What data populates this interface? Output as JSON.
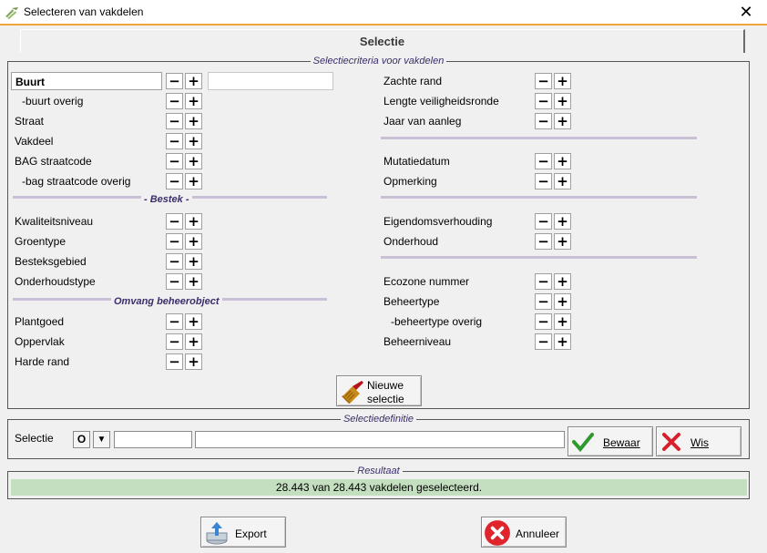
{
  "window": {
    "title": "Selecteren van vakdelen",
    "close_label": "✕"
  },
  "tab": {
    "label": "Selectie"
  },
  "criteria": {
    "title": "Selectiecriteria voor vakdelen",
    "left": [
      "Buurt",
      "-buurt overig",
      "Straat",
      "Vakdeel",
      "BAG straatcode",
      "-bag straatcode overig",
      "Kwaliteitsniveau",
      "Groentype",
      "Besteksgebied",
      "Onderhoudstype",
      "Plantgoed",
      "Oppervlak",
      "Harde rand"
    ],
    "left_sections": [
      "- Bestek -",
      "Omvang beheerobject"
    ],
    "right": [
      "Zachte rand",
      "Lengte veiligheidsronde",
      "Jaar van aanleg",
      "Mutatiedatum",
      "Opmerking",
      "Eigendomsverhouding",
      "Onderhoud",
      "Ecozone nummer",
      "Beheertype",
      "-beheertype overig",
      "Beheerniveau"
    ],
    "minus_label": "−",
    "plus_label": "+",
    "new_selection_line1": "Nieuwe",
    "new_selection_line2": "selectie"
  },
  "definition": {
    "title": "Selectiedefinitie",
    "label": "Selectie",
    "o_label": "O",
    "dropdown_label": "▼",
    "save_label": "Bewaar",
    "clear_label": "Wis"
  },
  "result": {
    "title": "Resultaat",
    "text": "28.443 van 28.443 vakdelen geselecteerd."
  },
  "footer": {
    "export_label": "Export",
    "cancel_label": "Annuleer"
  },
  "colors": {
    "accent": "#f2a53a",
    "group_title": "#3b2e6a",
    "result_bg": "#c4dfbf"
  }
}
